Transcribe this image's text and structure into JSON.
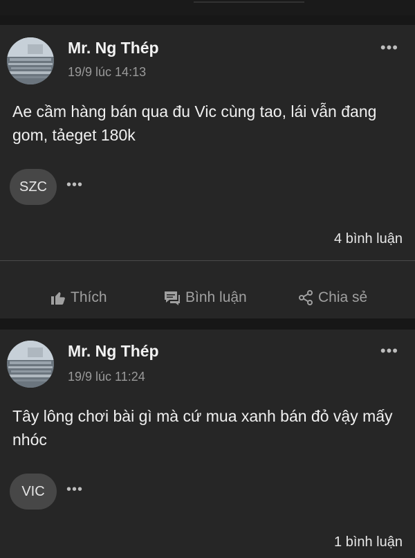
{
  "posts": [
    {
      "author": "Mr. Ng Thép",
      "time": "19/9 lúc 14:13",
      "text": "Ae cầm hàng bán qua đu Vic cùng tao, lái vẫn đang gom, tảeget 180k",
      "mention": "SZC",
      "comments": "4 bình luận",
      "actions": {
        "like": "Thích",
        "comment": "Bình luận",
        "share": "Chia sẻ"
      }
    },
    {
      "author": "Mr. Ng Thép",
      "time": "19/9 lúc 11:24",
      "text": "Tây lông chơi bài gì mà cứ mua xanh bán đỏ vậy mấy nhóc",
      "mention": "VIC",
      "comments": "1 bình luận"
    }
  ],
  "more_glyph": "•••",
  "icons": [
    "thumbs-up-icon",
    "comment-icon",
    "share-icon",
    "more-options-icon"
  ]
}
